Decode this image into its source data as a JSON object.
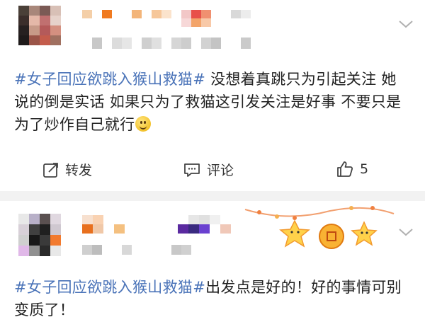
{
  "post1": {
    "text_topic": "#女子回应欲跳入猴山救猫#",
    "text_body": "没想着真跳只为引起关注 她说的倒是实话 如果只为了救猫这引发关注是好事 不要只是为了炒作自己就行",
    "emoji": "smile-emoji",
    "actions": {
      "repost_label": "转发",
      "comment_label": "评论",
      "like_count": "5"
    }
  },
  "post2": {
    "text_topic": "#女子回应欲跳入猴山救猫#",
    "text_body": "出发点是好的！好的事情可别变质了！"
  },
  "icons": {
    "more": "chevron-down-icon",
    "repost": "share-icon",
    "comment": "comment-icon",
    "like": "thumbs-up-icon"
  },
  "colors": {
    "topic": "#4a73b8",
    "separator": "#f2f2f2",
    "text": "#222222",
    "muted": "#b0b0b0"
  }
}
